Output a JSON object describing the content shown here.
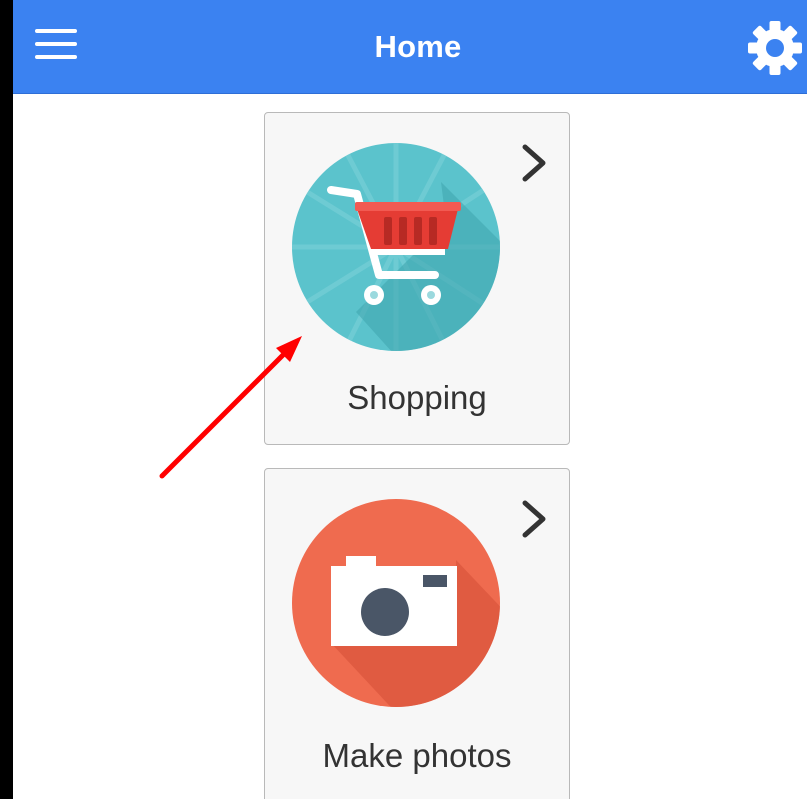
{
  "header": {
    "title": "Home",
    "menu_icon": "hamburger-menu-icon",
    "settings_icon": "gear-icon",
    "background_color": "#3b82f1"
  },
  "cards": [
    {
      "label": "Shopping",
      "icon": "shopping-cart-icon",
      "icon_color": "#5bc3cc",
      "chevron_icon": "chevron-right-icon"
    },
    {
      "label": "Make photos",
      "icon": "camera-icon",
      "icon_color": "#ef6b4f",
      "chevron_icon": "chevron-right-icon"
    }
  ],
  "annotation": {
    "arrow_color": "#ff0000",
    "arrow_target": "Shopping"
  }
}
